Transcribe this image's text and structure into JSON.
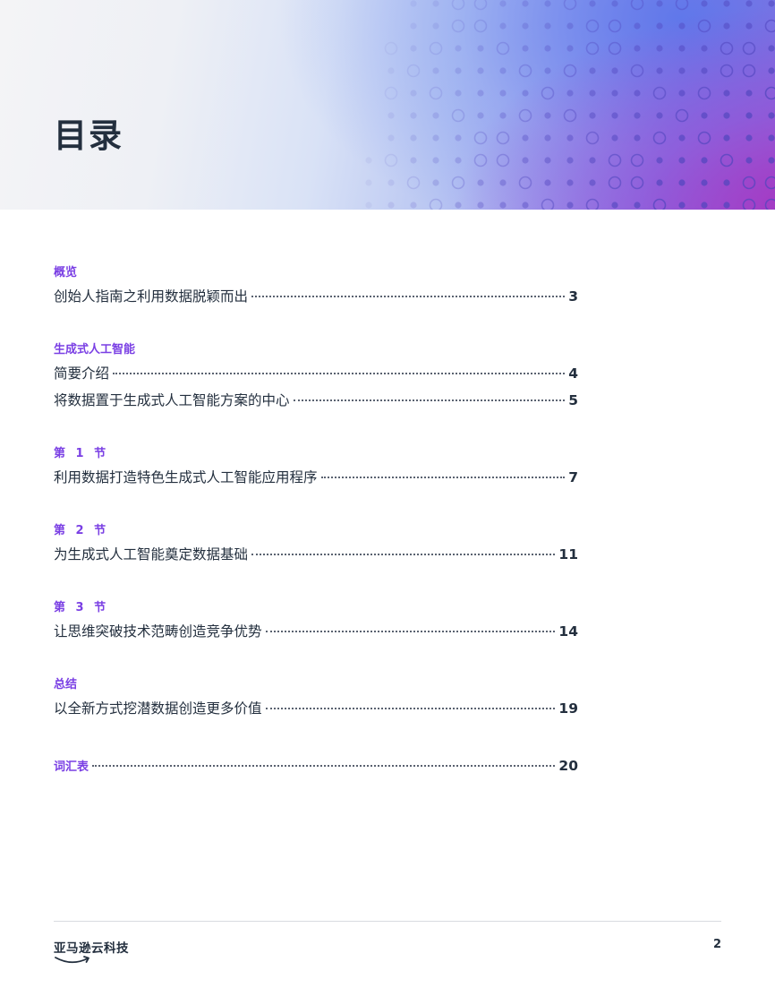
{
  "header": {
    "title": "目录"
  },
  "toc": {
    "sections": [
      {
        "label": "概览",
        "entries": [
          {
            "title": "创始人指南之利用数据脱颖而出",
            "page": "3"
          }
        ]
      },
      {
        "label": "生成式人工智能",
        "entries": [
          {
            "title": "简要介绍",
            "page": "4"
          },
          {
            "title": "将数据置于生成式人工智能方案的中心",
            "page": "5"
          }
        ]
      },
      {
        "label": "第 1 节",
        "entries": [
          {
            "title": "利用数据打造特色生成式人工智能应用程序",
            "page": "7"
          }
        ]
      },
      {
        "label": "第 2 节",
        "entries": [
          {
            "title": "为生成式人工智能奠定数据基础",
            "page": "11"
          }
        ]
      },
      {
        "label": "第 3 节",
        "entries": [
          {
            "title": "让思维突破技术范畴创造竞争优势",
            "page": "14"
          }
        ]
      },
      {
        "label": "总结",
        "entries": [
          {
            "title": "以全新方式挖潜数据创造更多价值",
            "page": "19"
          }
        ]
      }
    ],
    "glossary": {
      "label": "词汇表",
      "page": "20"
    }
  },
  "footer": {
    "brand": "亚马逊云科技",
    "page_number": "2"
  },
  "colors": {
    "accent": "#7a3fe4",
    "text": "#232f3e",
    "rule": "#d8dbe0"
  }
}
